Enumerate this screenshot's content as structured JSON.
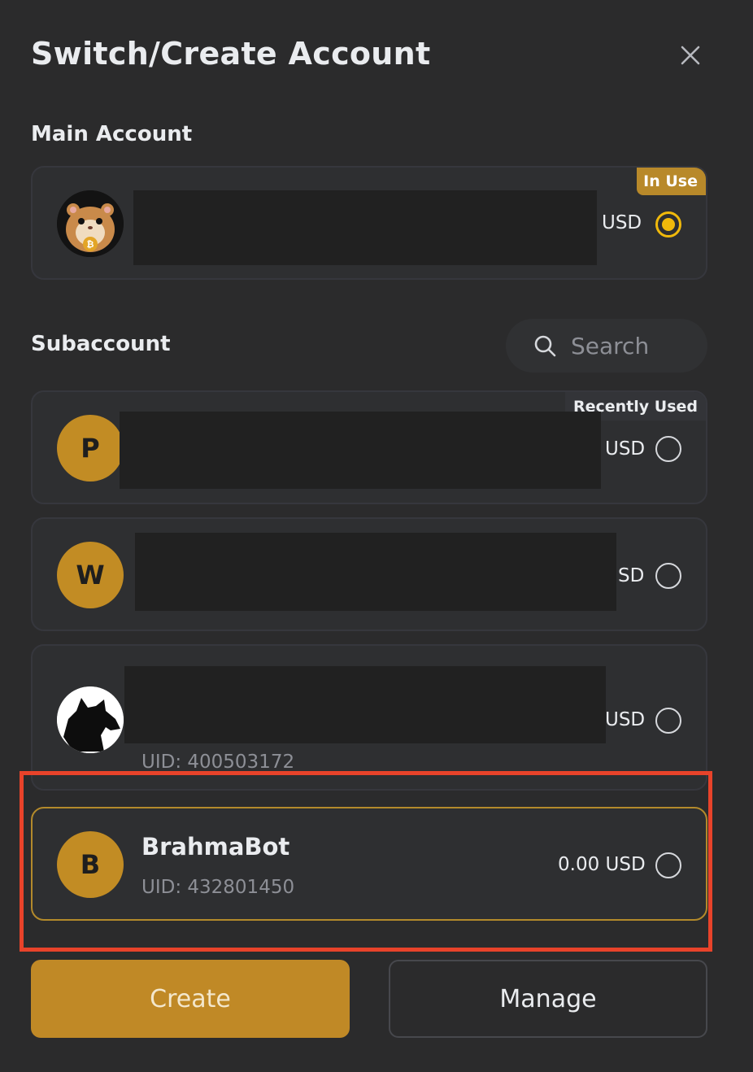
{
  "dialog": {
    "title": "Switch/Create Account"
  },
  "main_account": {
    "section_label": "Main Account",
    "tag": "In Use",
    "currency": "USD",
    "selected": true
  },
  "subaccount": {
    "section_label": "Subaccount",
    "search_placeholder": "Search",
    "recent_tag": "Recently Used",
    "items": [
      {
        "initial": "P",
        "currency": "USD",
        "selected": false
      },
      {
        "initial": "W",
        "currency": "SD",
        "selected": false
      },
      {
        "currency": "USD",
        "uid": "UID: 400503172",
        "selected": false
      },
      {
        "initial": "B",
        "name": "BrahmaBot",
        "uid": "UID: 432801450",
        "balance": "0.00 USD",
        "selected": false
      }
    ]
  },
  "footer": {
    "create_label": "Create",
    "manage_label": "Manage"
  },
  "colors": {
    "background": "#2b2b2c",
    "accent": "#f0b90b",
    "button_primary": "#c08926",
    "highlight": "#e8432a"
  }
}
